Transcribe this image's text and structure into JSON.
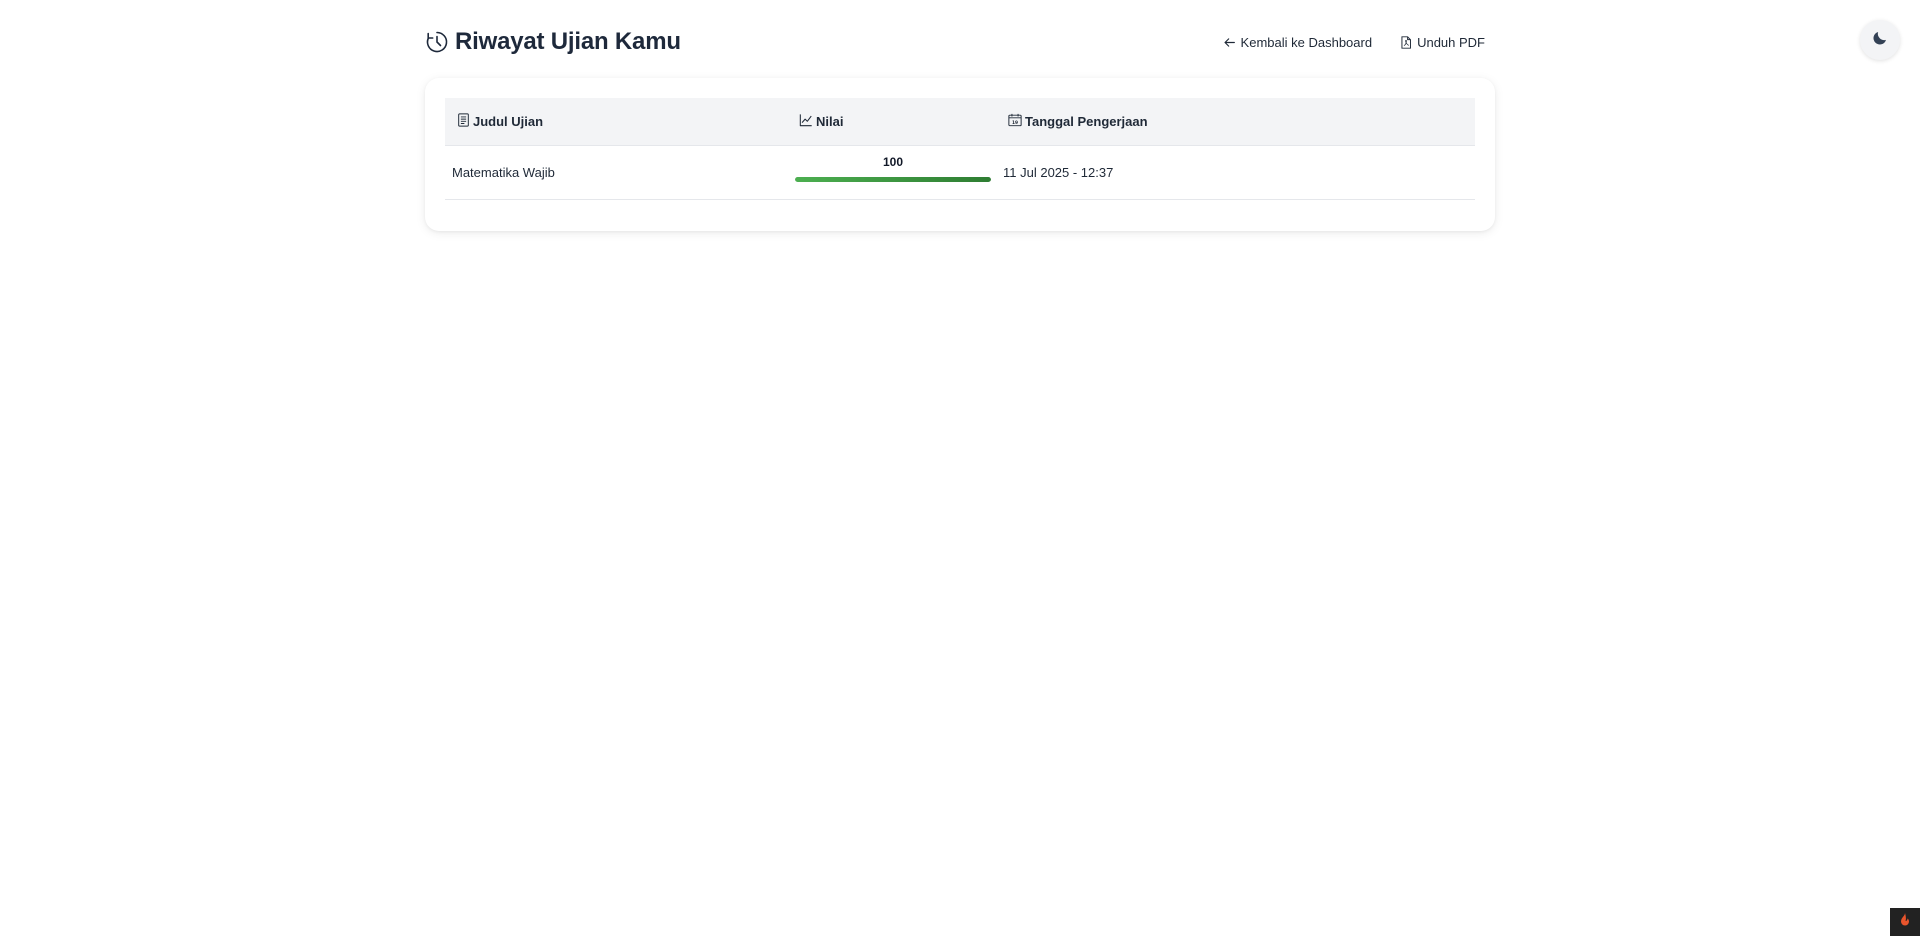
{
  "header": {
    "title": "Riwayat Ujian Kamu",
    "title_icon": "clock-icon",
    "back_label": "Kembali ke Dashboard",
    "pdf_label": "Unduh PDF"
  },
  "table": {
    "columns": [
      {
        "label": "Judul Ujian",
        "icon": "document-icon"
      },
      {
        "label": "Nilai",
        "icon": "chart-line-icon"
      },
      {
        "label": "Tanggal Pengerjaan",
        "icon": "calendar-icon"
      }
    ],
    "rows": [
      {
        "title": "Matematika Wajib",
        "score": "100",
        "score_fraction": 1.0,
        "date": "11 Jul 2025 - 12:37"
      }
    ]
  },
  "colors": {
    "score_bar_start": "#4caf50",
    "score_bar_end": "#2e7d32",
    "header_bg": "#f3f4f6"
  },
  "theme_toggle_icon": "moon-icon",
  "corner_badge_icon": "flame-icon"
}
